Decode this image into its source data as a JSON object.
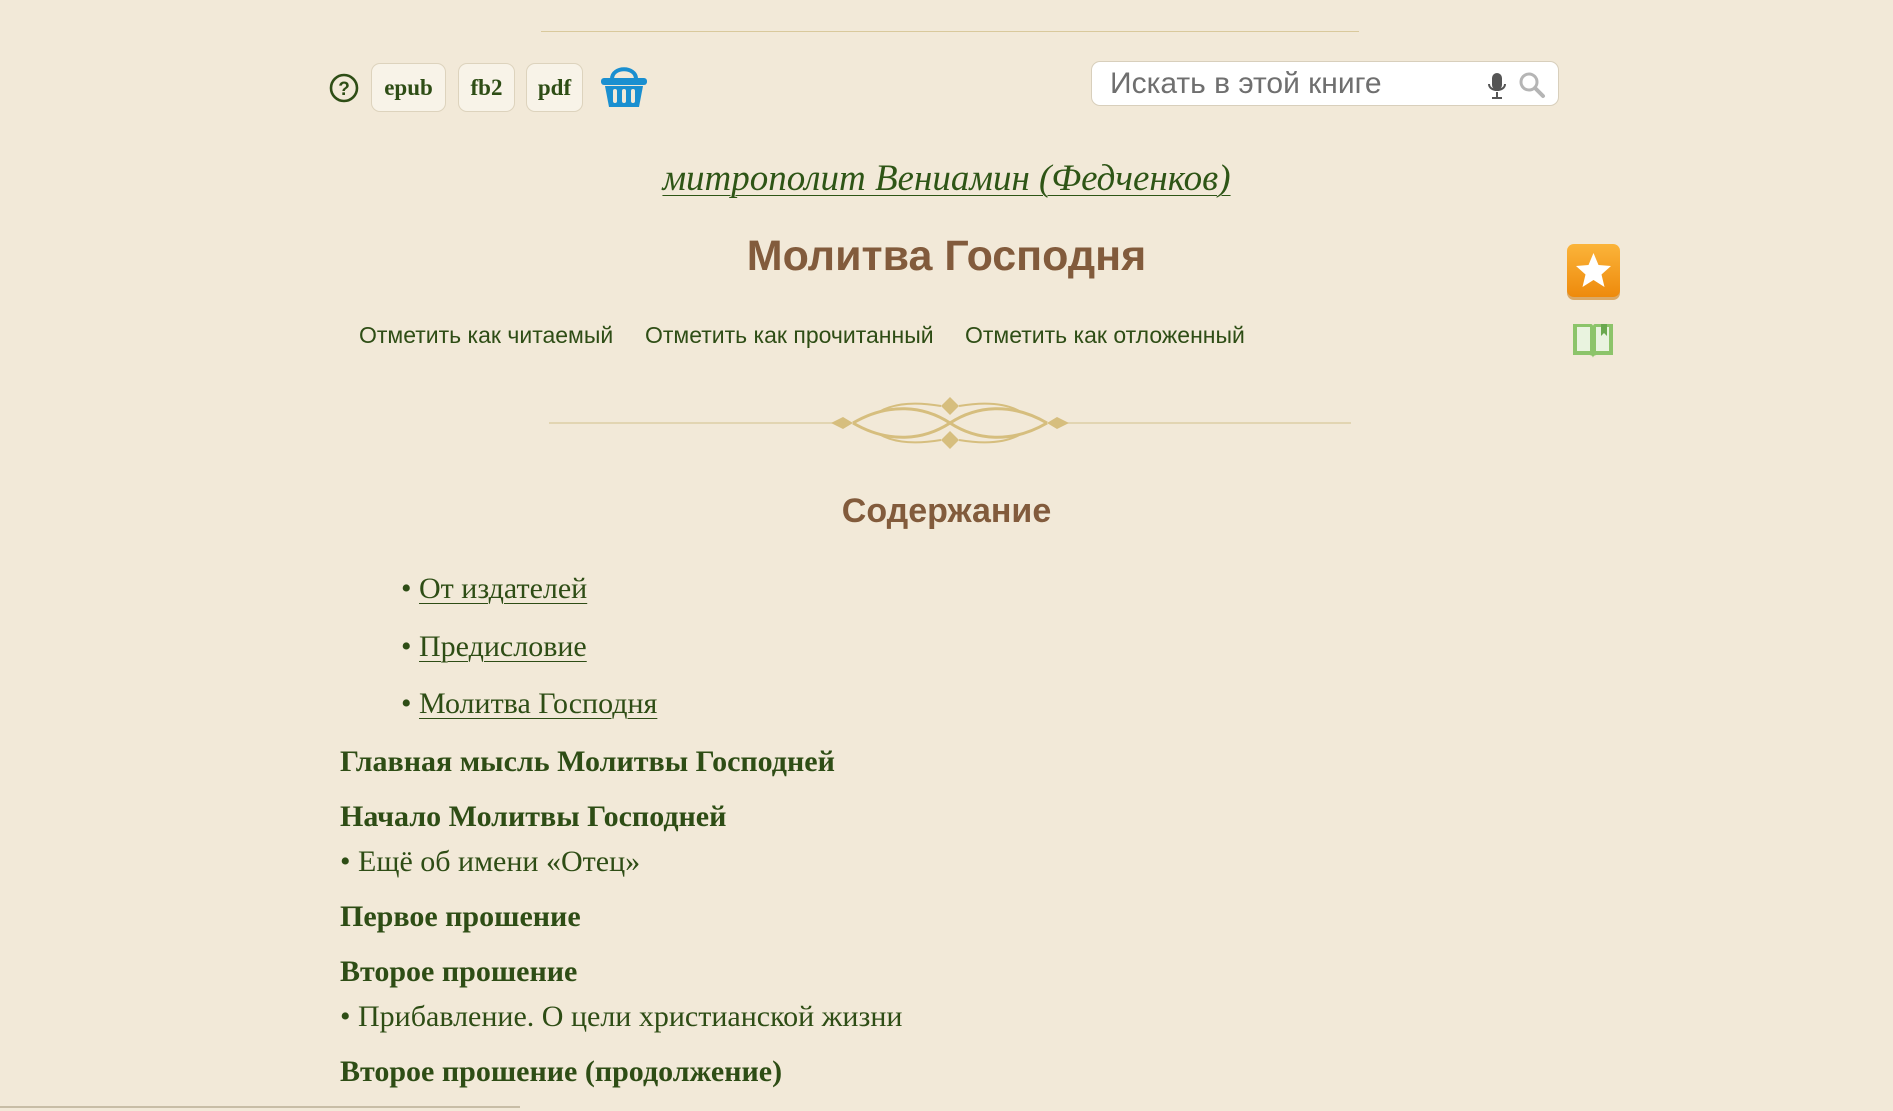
{
  "toolbar": {
    "formats": [
      "epub",
      "fb2",
      "pdf"
    ]
  },
  "search": {
    "placeholder": "Искать в этой книге"
  },
  "book": {
    "author": "митрополит Вениамин (Федченков)",
    "title": "Молитва Господня"
  },
  "marks": {
    "reading": "Отметить как читаемый",
    "read": "Отметить как прочитанный",
    "deferred": "Отметить как отложенный"
  },
  "toc": {
    "heading": "Содержание",
    "bullet": "•",
    "items": [
      {
        "text": "От издателей",
        "style": "indent"
      },
      {
        "text": "Предисловие",
        "style": "indent"
      },
      {
        "text": "Молитва Господня",
        "style": "indent"
      },
      {
        "text": "Главная мысль Молитвы Господней",
        "style": "bold"
      },
      {
        "text": "Начало Молитвы Господней",
        "style": "bold"
      },
      {
        "text": "Ещё об имени «Отец»",
        "style": "sub"
      },
      {
        "text": "Первое прошение",
        "style": "bold"
      },
      {
        "text": "Второе прошение",
        "style": "bold"
      },
      {
        "text": "Прибавление. О цели христианской жизни",
        "style": "sub"
      },
      {
        "text": "Второе прошение (продолжение)",
        "style": "bold"
      }
    ]
  },
  "colors": {
    "background": "#f2e9d8",
    "link_green": "#2e4d15",
    "title_brown": "#825b3c",
    "ornament_gold": "#d6be7e",
    "basket_blue": "#1a8fd0",
    "star_orange": "#f5a01a",
    "book_green": "#8cc46a"
  },
  "icons": [
    "help-icon",
    "basket-icon",
    "microphone-icon",
    "magnifier-icon",
    "favorite-star-icon",
    "open-book-icon"
  ]
}
